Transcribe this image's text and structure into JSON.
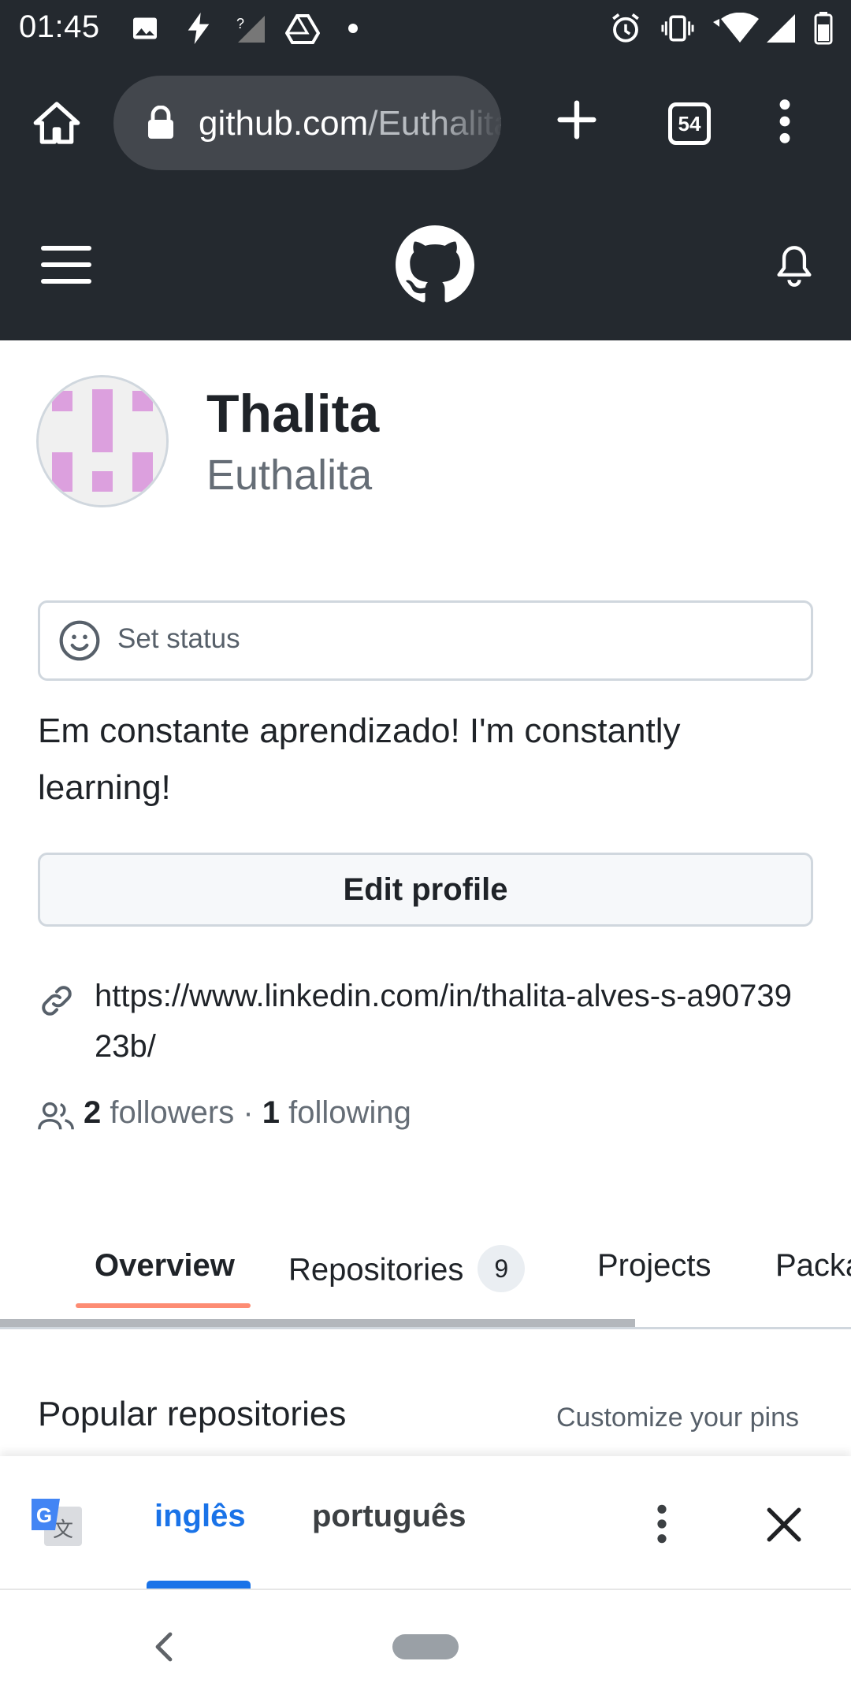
{
  "status_bar": {
    "time": "01:45",
    "icons_left": [
      "gallery-icon",
      "bolt-icon",
      "no-signal-icon",
      "drive-icon",
      "dot-icon"
    ],
    "icons_right": [
      "alarm-icon",
      "vibrate-icon",
      "wifi-icon",
      "signal-icon",
      "battery-icon"
    ]
  },
  "browser": {
    "url_host": "github.com",
    "url_path": "/Euthalita",
    "tab_count": "54"
  },
  "profile": {
    "display_name": "Thalita",
    "username": "Euthalita",
    "status_placeholder": "Set status",
    "bio": "Em constante aprendizado! I'm constantly learning!",
    "edit_button": "Edit profile",
    "link": "https://www.linkedin.com/in/thalita-alves-s-a9073923b/",
    "followers_count": "2",
    "followers_label": "followers",
    "separator": "·",
    "following_count": "1",
    "following_label": "following"
  },
  "tabs": [
    {
      "label": "Overview",
      "active": true
    },
    {
      "label": "Repositories",
      "count": "9"
    },
    {
      "label": "Projects"
    },
    {
      "label": "Packages"
    }
  ],
  "section": {
    "title": "Popular repositories",
    "action": "Customize your pins"
  },
  "translate_bar": {
    "source_lang": "inglês",
    "target_lang": "português"
  },
  "colors": {
    "header_bg": "#24292f",
    "tab_underline": "#fd8c73",
    "translate_accent": "#1a73e8",
    "avatar_pattern": "#dca0de"
  }
}
